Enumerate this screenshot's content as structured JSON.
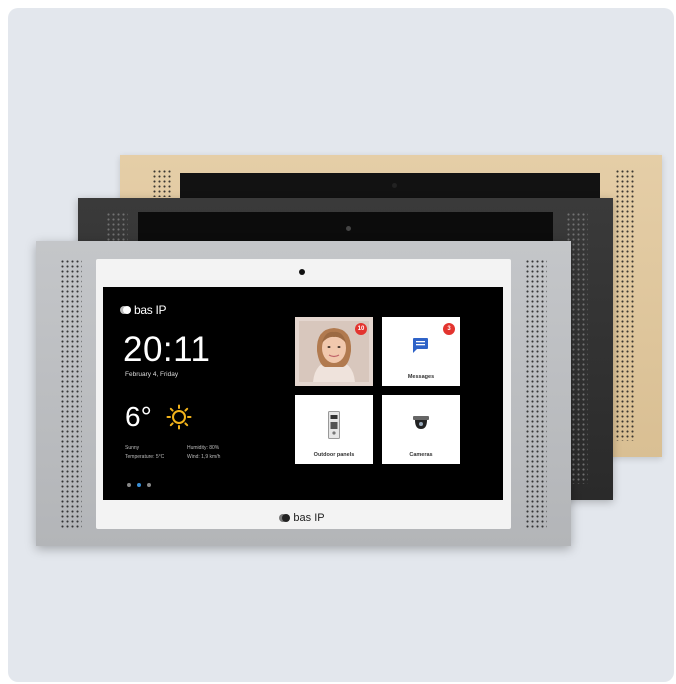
{
  "product": {
    "screen": {
      "logo_text": "bas IP",
      "time": "20:11",
      "date": "February 4, Friday",
      "temperature": "6°",
      "weather_left": [
        "Sunny",
        "Temperature: 5°C"
      ],
      "weather_right": [
        "Humidity: 80%",
        "Wind: 1,9 km/h"
      ],
      "page_dots": 3,
      "active_dot": 1
    },
    "tiles": [
      {
        "label": "",
        "badge": "10",
        "icon": "person-photo"
      },
      {
        "label": "Messages",
        "badge": "3",
        "icon": "message-icon"
      },
      {
        "label": "Outdoor panels",
        "badge": "",
        "icon": "outdoor-panel-icon"
      },
      {
        "label": "Cameras",
        "badge": "",
        "icon": "dome-camera-icon"
      }
    ],
    "bezel_logo_text": "bas IP",
    "panel_colors": {
      "gold": "#dcc398",
      "black": "#2f2f2f",
      "silver": "#bcbec1"
    },
    "accent": "#3a8fd6",
    "badge_color": "#e3342f"
  }
}
